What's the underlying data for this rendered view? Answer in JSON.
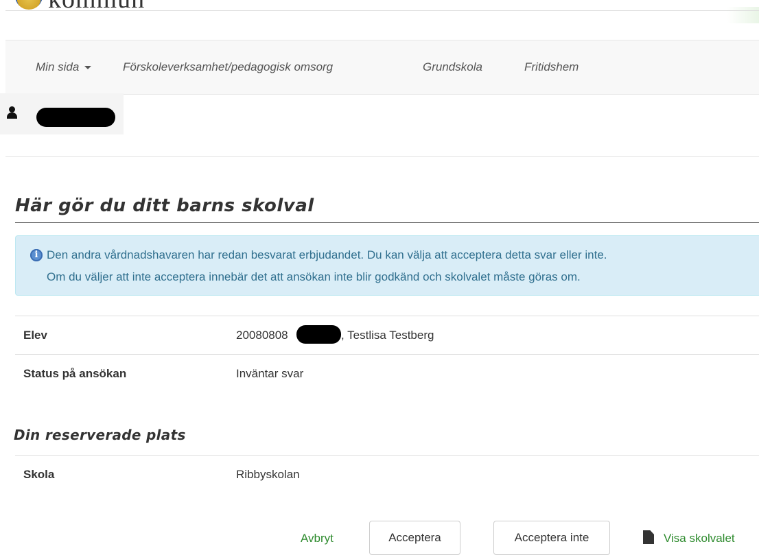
{
  "header": {
    "logo_text": "kommun"
  },
  "nav": {
    "items": [
      {
        "label": "Min sida",
        "has_dropdown": true
      },
      {
        "label": "Förskoleverksamhet/pedagogisk omsorg"
      },
      {
        "label": "Grundskola"
      },
      {
        "label": "Fritidshem"
      }
    ]
  },
  "user": {
    "icon": "user-icon"
  },
  "page": {
    "title": "Här gör du ditt barns skolval"
  },
  "alert": {
    "icon": "info-icon",
    "line1": "Den andra vårdnadshavaren har redan besvarat erbjudandet. Du kan välja att acceptera detta svar eller inte.",
    "line2": "Om du väljer att inte acceptera innebär det att ansökan inte blir godkänd och skolvalet måste göras om."
  },
  "details": [
    {
      "label": "Elev",
      "value_prefix": "20080808",
      "value_suffix": ", Testlisa Testberg"
    },
    {
      "label": "Status på ansökan",
      "value": "Inväntar svar"
    }
  ],
  "reserved": {
    "title": "Din reserverade plats",
    "rows": [
      {
        "label": "Skola",
        "value": "Ribbyskolan"
      }
    ]
  },
  "actions": {
    "cancel_label": "Avbryt",
    "accept_label": "Acceptera",
    "decline_label": "Acceptera inte",
    "view_label": "Visa skolvalet",
    "view_icon": "file-icon"
  },
  "colors": {
    "alert_bg": "#d9edf7",
    "alert_text": "#31708f",
    "link_green": "#2e8b2e",
    "navbar_bg": "#f8f8f8"
  }
}
